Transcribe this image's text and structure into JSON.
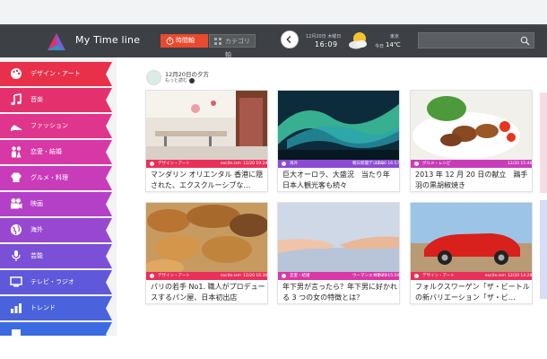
{
  "header": {
    "app_title": "My Time line",
    "time_button": "時間軸",
    "category_button": "カテゴリ軸",
    "date": "12月20日 木曜日",
    "time": "16:09",
    "today_label": "今日",
    "city": "東京",
    "temperature": "14℃",
    "search_placeholder": ""
  },
  "colors": {
    "header_bg": "#3d4145",
    "accent": "#e94a2d"
  },
  "sidebar": {
    "items": [
      {
        "label": "デザイン・アート",
        "icon": "palette-icon",
        "color": "#e8304a"
      },
      {
        "label": "音楽",
        "icon": "music-note-icon",
        "color": "#e5306e"
      },
      {
        "label": "ファッション",
        "icon": "high-heel-icon",
        "color": "#e0358c"
      },
      {
        "label": "恋愛・結婚",
        "icon": "couple-icon",
        "color": "#d838a6"
      },
      {
        "label": "グルメ・料理",
        "icon": "chef-hat-icon",
        "color": "#c83cba"
      },
      {
        "label": "映画",
        "icon": "film-camera-icon",
        "color": "#b440c8"
      },
      {
        "label": "海外",
        "icon": "globe-icon",
        "color": "#9848d0"
      },
      {
        "label": "芸能",
        "icon": "microphone-icon",
        "color": "#7c50d6"
      },
      {
        "label": "テレビ・ラジオ",
        "icon": "tv-icon",
        "color": "#6058da"
      },
      {
        "label": "トレンド",
        "icon": "bar-chart-icon",
        "color": "#4a62dc"
      },
      {
        "label": "",
        "icon": "category-icon",
        "color": "#3c6ae0"
      }
    ]
  },
  "section": {
    "title": "12月20日の夕方",
    "more": "もっと読む"
  },
  "cards": [
    {
      "category": "デザイン・アート",
      "source": "excite.ism",
      "date": "12/20 19:24",
      "title": "マンダリン オリエンタル 香港に隠された、エクスクルーシブな…",
      "color": "#e8305a",
      "image": "restaurant-photo"
    },
    {
      "category": "海外",
      "source": "朝日新聞デジタル",
      "date": "12/20 16:57",
      "title": "巨大オーロラ、大盛況　当たり年　日本人観光客も続々",
      "color": "#8c4ad4",
      "image": "aurora-photo"
    },
    {
      "category": "グルメ・レシピ",
      "source": "",
      "date": "12/20 15:46",
      "title": "2013 年 12 月 20 日の献立　鶏手羽の黒胡椒焼き",
      "color": "#c83cba",
      "image": "chicken-dish-photo"
    },
    {
      "category": "デザイン・アート",
      "source": "excite.ism",
      "date": "12/20 16:30",
      "title": "パリの若手 No1. 職人がプロデュースするパン屋、日本初出店",
      "color": "#e8305a",
      "image": "bread-photo"
    },
    {
      "category": "恋愛・結婚",
      "source": "ウーマンエキサイト",
      "date": "12/20 15:50",
      "title": "年下男が言ったら？年下男に好かれる 3 つの女の特徴とは？",
      "color": "#d838a6",
      "image": "hands-photo"
    },
    {
      "category": "デザイン・アート",
      "source": "excite.ism",
      "date": "12/20 14:20",
      "title": "フォルクスワーゲン「ザ・ビートルの新バリエーション「ザ・ビ…",
      "color": "#e8305a",
      "image": "red-car-photo"
    }
  ]
}
